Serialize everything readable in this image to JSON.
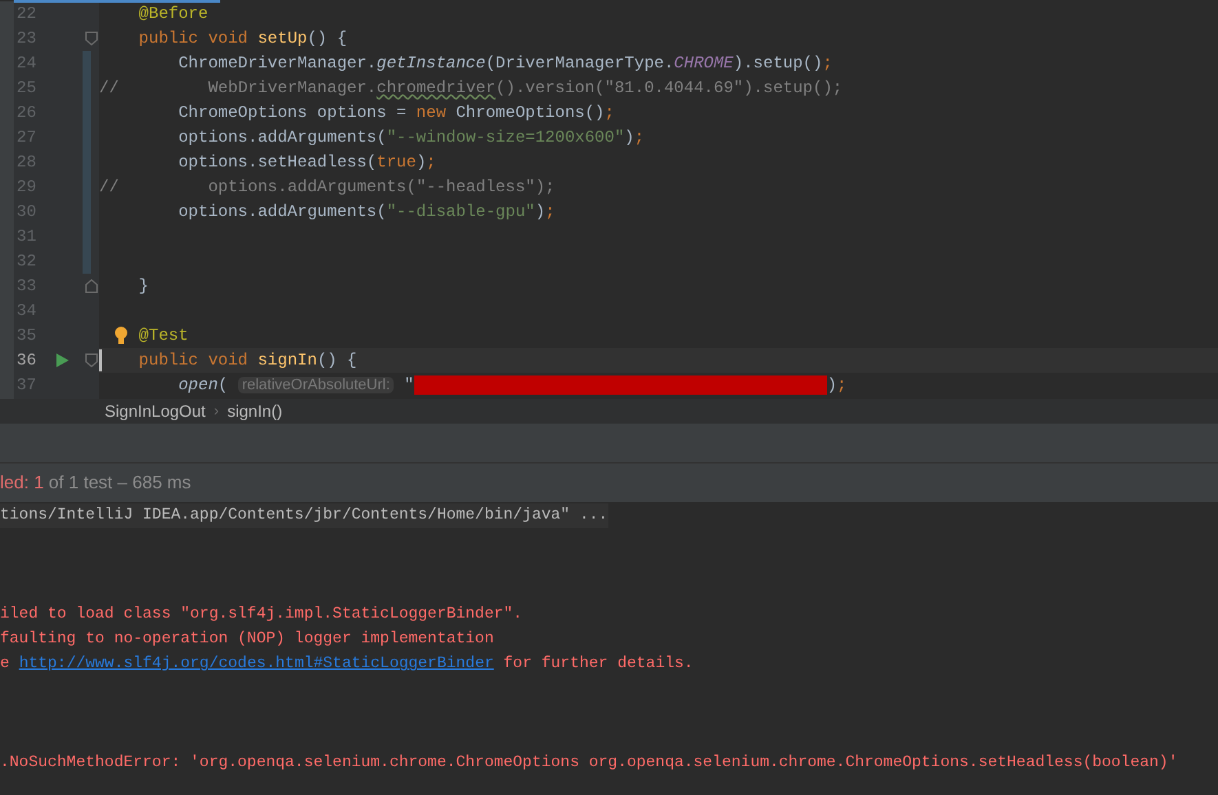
{
  "editor": {
    "lines": [
      {
        "number": "22",
        "tokens": [
          {
            "t": "    @Before",
            "kind": "annotation"
          }
        ]
      },
      {
        "number": "23",
        "fold_start": true,
        "tokens": [
          {
            "t": "    public void ",
            "kind": "keyword"
          },
          {
            "t": "setUp",
            "kind": "decl"
          },
          {
            "t": "() {",
            "kind": "plain"
          }
        ]
      },
      {
        "number": "24",
        "changed": true,
        "tokens": [
          {
            "t": "        ChromeDriverManager.",
            "kind": "plain"
          },
          {
            "t": "getInstance",
            "kind": "italic"
          },
          {
            "t": "(DriverManagerType.",
            "kind": "plain"
          },
          {
            "t": "CHROME",
            "kind": "constant"
          },
          {
            "t": ").setup()",
            "kind": "plain"
          },
          {
            "t": ";",
            "kind": "keyword"
          }
        ]
      },
      {
        "number": "25",
        "changed": true,
        "tokens": [
          {
            "t": "//         WebDriverManager.",
            "kind": "comment"
          },
          {
            "t": "chromedriver",
            "kind": "typo"
          },
          {
            "t": "().version(\"81.0.4044.69\").setup();",
            "kind": "comment"
          }
        ]
      },
      {
        "number": "26",
        "changed": true,
        "tokens": [
          {
            "t": "        ChromeOptions options = ",
            "kind": "plain"
          },
          {
            "t": "new ",
            "kind": "keyword"
          },
          {
            "t": "ChromeOptions()",
            "kind": "plain"
          },
          {
            "t": ";",
            "kind": "keyword"
          }
        ]
      },
      {
        "number": "27",
        "changed": true,
        "tokens": [
          {
            "t": "        options.addArguments(",
            "kind": "plain"
          },
          {
            "t": "\"--window-size=1200x600\"",
            "kind": "string"
          },
          {
            "t": ")",
            "kind": "plain"
          },
          {
            "t": ";",
            "kind": "keyword"
          }
        ]
      },
      {
        "number": "28",
        "changed": true,
        "tokens": [
          {
            "t": "        options.setHeadless(",
            "kind": "plain"
          },
          {
            "t": "true",
            "kind": "keyword"
          },
          {
            "t": ")",
            "kind": "plain"
          },
          {
            "t": ";",
            "kind": "keyword"
          }
        ]
      },
      {
        "number": "29",
        "changed": true,
        "tokens": [
          {
            "t": "//         options.addArguments(\"--headless\");",
            "kind": "comment"
          }
        ]
      },
      {
        "number": "30",
        "changed": true,
        "tokens": [
          {
            "t": "        options.addArguments(",
            "kind": "plain"
          },
          {
            "t": "\"--disable-gpu\"",
            "kind": "string"
          },
          {
            "t": ")",
            "kind": "plain"
          },
          {
            "t": ";",
            "kind": "keyword"
          }
        ]
      },
      {
        "number": "31",
        "changed": true
      },
      {
        "number": "32",
        "changed": true
      },
      {
        "number": "33",
        "fold_end": true,
        "tokens": [
          {
            "t": "    }",
            "kind": "plain"
          }
        ]
      },
      {
        "number": "34"
      },
      {
        "number": "35",
        "bulb": true,
        "tokens": [
          {
            "t": "    @Test",
            "kind": "annotation"
          }
        ]
      },
      {
        "number": "36",
        "run": true,
        "fold_start": true,
        "current": true,
        "tokens": [
          {
            "t": "    public void ",
            "kind": "keyword"
          },
          {
            "t": "signIn",
            "kind": "decl"
          },
          {
            "t": "() {",
            "kind": "plain"
          }
        ]
      },
      {
        "number": "37",
        "tokens": [
          {
            "t": "        open",
            "kind": "italic"
          },
          {
            "t": "( ",
            "kind": "plain"
          },
          {
            "t": "relativeOrAbsoluteUrl:",
            "kind": "hint"
          },
          {
            "t": " \"",
            "kind": "plain"
          },
          {
            "kind": "redacted"
          },
          {
            "t": ")",
            "kind": "plain"
          },
          {
            "t": ";",
            "kind": "keyword"
          }
        ]
      }
    ]
  },
  "breadcrumbs": {
    "separator": "›",
    "items": [
      {
        "label": "SignInLogOut"
      },
      {
        "label": "signIn()"
      }
    ]
  },
  "test_status": {
    "failed": "led: 1",
    "summary": " of 1 test – 685 ms"
  },
  "console": [
    {
      "kind": "command",
      "text": "tions/IntelliJ IDEA.app/Contents/jbr/Contents/Home/bin/java\" ..."
    },
    {
      "kind": "blank"
    },
    {
      "kind": "blank"
    },
    {
      "kind": "blank"
    },
    {
      "kind": "error",
      "text": "iled to load class \"org.slf4j.impl.StaticLoggerBinder\"."
    },
    {
      "kind": "error",
      "text": "faulting to no-operation (NOP) logger implementation"
    },
    {
      "kind": "error",
      "text": "e ",
      "link": "http://www.slf4j.org/codes.html#StaticLoggerBinder",
      "after": " for further details."
    },
    {
      "kind": "blank"
    },
    {
      "kind": "blank"
    },
    {
      "kind": "blank"
    },
    {
      "kind": "error",
      "text": ".NoSuchMethodError: 'org.openqa.selenium.chrome.ChromeOptions org.openqa.selenium.chrome.ChromeOptions.setHeadless(boolean)'"
    }
  ]
}
